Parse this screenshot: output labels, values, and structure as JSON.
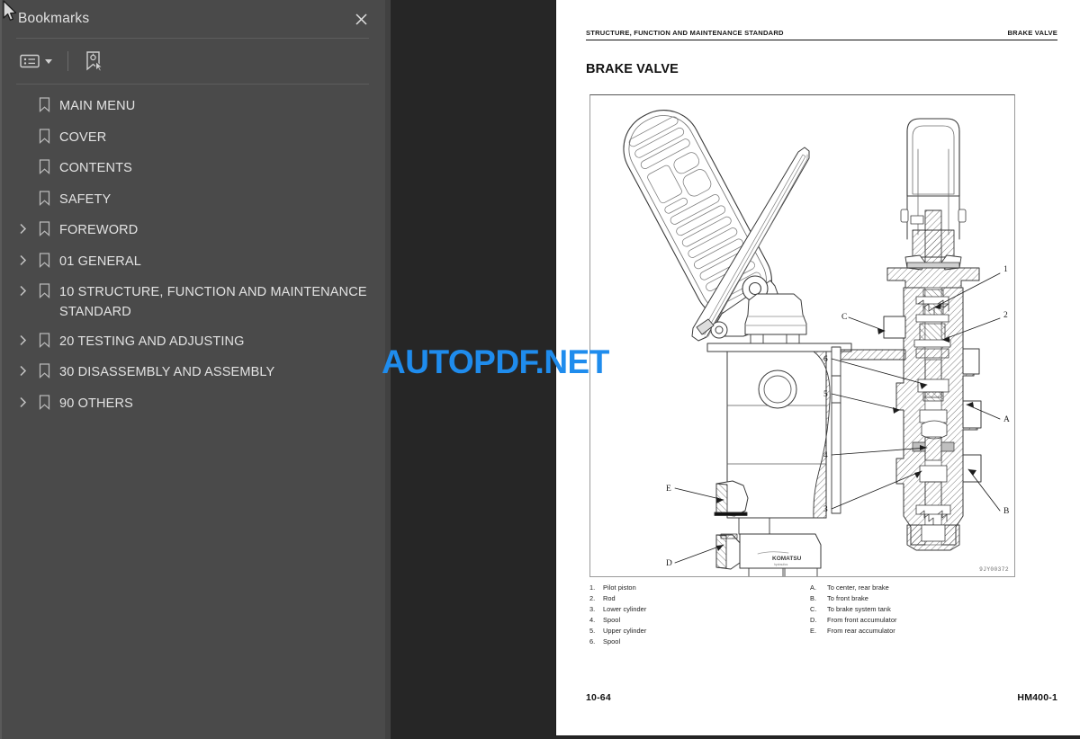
{
  "sidebar": {
    "title": "Bookmarks",
    "close_icon": "close-icon",
    "toolbar": {
      "options_label": "Bookmark options",
      "options_icon": "list-options-icon",
      "dropdown_icon": "chevron-down-icon",
      "new_bookmark_label": "New bookmark",
      "new_bookmark_icon": "add-bookmark-icon"
    },
    "items": [
      {
        "label": "MAIN MENU",
        "expandable": false
      },
      {
        "label": "COVER",
        "expandable": false
      },
      {
        "label": "CONTENTS",
        "expandable": false
      },
      {
        "label": "SAFETY",
        "expandable": false
      },
      {
        "label": "FOREWORD",
        "expandable": true
      },
      {
        "label": "01 GENERAL",
        "expandable": true
      },
      {
        "label": "10 STRUCTURE, FUNCTION AND MAINTENANCE STANDARD",
        "expandable": true
      },
      {
        "label": "20 TESTING AND ADJUSTING",
        "expandable": true
      },
      {
        "label": "30 DISASSEMBLY AND ASSEMBLY",
        "expandable": true
      },
      {
        "label": "90 OTHERS",
        "expandable": true
      }
    ]
  },
  "watermark": {
    "text": "AUTOPDF.NET",
    "color": "#1f8ced"
  },
  "page": {
    "running_head_left": "STRUCTURE, FUNCTION AND MAINTENANCE STANDARD",
    "running_head_right": "BRAKE VALVE",
    "title": "BRAKE VALVE",
    "figure_id": "9JY00372",
    "legend_numbered": [
      {
        "key": "1.",
        "text": "Pilot piston"
      },
      {
        "key": "2.",
        "text": "Rod"
      },
      {
        "key": "3.",
        "text": "Lower cylinder"
      },
      {
        "key": "4.",
        "text": "Spool"
      },
      {
        "key": "5.",
        "text": "Upper cylinder"
      },
      {
        "key": "6.",
        "text": "Spool"
      }
    ],
    "legend_lettered": [
      {
        "key": "A.",
        "text": "To center, rear brake"
      },
      {
        "key": "B.",
        "text": "To front brake"
      },
      {
        "key": "C.",
        "text": "To brake system tank"
      },
      {
        "key": "D.",
        "text": "From front accumulator"
      },
      {
        "key": "E.",
        "text": "From rear accumulator"
      }
    ],
    "footer_left": "10-64",
    "footer_right": "HM400-1",
    "callouts": [
      "1",
      "2",
      "3",
      "4",
      "5",
      "6",
      "A",
      "B",
      "C",
      "D",
      "E"
    ]
  },
  "colors": {
    "sidebar_bg": "#4a4a4a",
    "viewer_bg": "#262626",
    "page_bg": "#ffffff",
    "accent": "#1f8ced"
  }
}
